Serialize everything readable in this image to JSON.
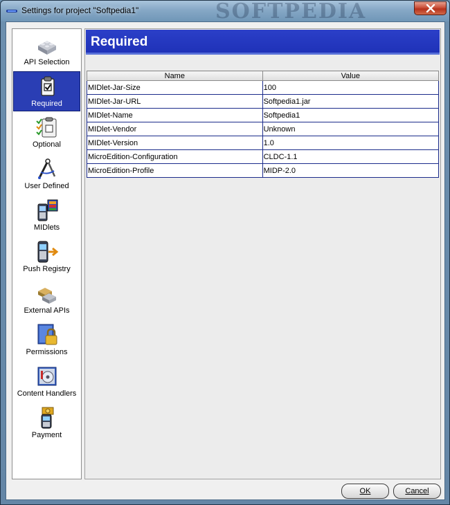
{
  "window": {
    "title": "Settings for project \"Softpedia1\"",
    "watermark": "SOFTPEDIA"
  },
  "sidebar": {
    "items": [
      {
        "label": "API Selection",
        "icon": "api-blocks-icon"
      },
      {
        "label": "Required",
        "icon": "clipboard-check-icon",
        "selected": true
      },
      {
        "label": "Optional",
        "icon": "checklist-icon"
      },
      {
        "label": "User Defined",
        "icon": "compass-icon"
      },
      {
        "label": "MIDlets",
        "icon": "phone-app-icon"
      },
      {
        "label": "Push Registry",
        "icon": "phone-push-icon"
      },
      {
        "label": "External APIs",
        "icon": "external-blocks-icon"
      },
      {
        "label": "Permissions",
        "icon": "lock-icon"
      },
      {
        "label": "Content Handlers",
        "icon": "disc-icon"
      },
      {
        "label": "Payment",
        "icon": "phone-coin-icon"
      }
    ]
  },
  "main": {
    "section_title": "Required",
    "table": {
      "headers": [
        "Name",
        "Value"
      ],
      "rows": [
        [
          "MIDlet-Jar-Size",
          "100"
        ],
        [
          "MIDlet-Jar-URL",
          "Softpedia1.jar"
        ],
        [
          "MIDlet-Name",
          "Softpedia1"
        ],
        [
          "MIDlet-Vendor",
          "Unknown"
        ],
        [
          "MIDlet-Version",
          "1.0"
        ],
        [
          "MicroEdition-Configuration",
          "CLDC-1.1"
        ],
        [
          "MicroEdition-Profile",
          "MIDP-2.0"
        ]
      ]
    }
  },
  "buttons": {
    "ok": "OK",
    "cancel": "Cancel"
  },
  "colors": {
    "accent": "#2a3eb4",
    "banner": "#1f32b8",
    "grid": "#1a2a8a"
  }
}
